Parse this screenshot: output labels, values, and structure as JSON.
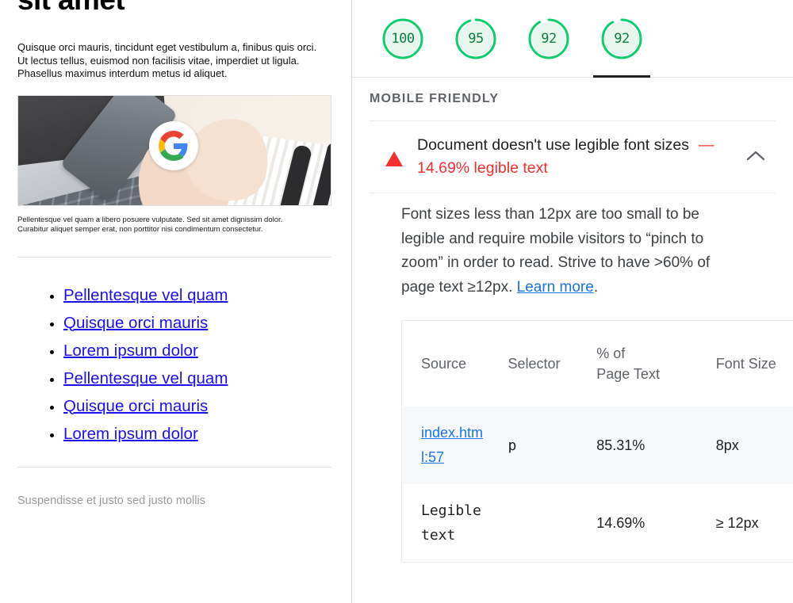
{
  "page_preview": {
    "heading": "sit amet",
    "paragraph": "Quisque orci mauris, tincidunt eget vestibulum a, finibus quis orci. Ut lectus tellus, euismod non facilisis vitae, imperdiet ut ligula. Phasellus maximus interdum metus id aliquet.",
    "image_alt": "hands-holding-phone-over-laptop-with-google-logo",
    "caption": "Pellentesque vel quam a libero posuere vulputate. Sed sit amet dignissim dolor. Curabitur aliquet semper erat, non porttitor nisi condimentum consectetur.",
    "links": [
      "Pellentesque vel quam",
      "Quisque orci mauris",
      "Lorem ipsum dolor",
      "Pellentesque vel quam",
      "Quisque orci mauris",
      "Lorem ipsum dolor"
    ],
    "footer": "Suspendisse et justo sed justo mollis",
    "link_color": "#1a12ee",
    "footer_color": "#9a9a9a"
  },
  "audit_pane": {
    "gauges": [
      {
        "score": "100",
        "percent": 100,
        "active": false,
        "color": "#0cce6b"
      },
      {
        "score": "95",
        "percent": 95,
        "active": false,
        "color": "#0cce6b"
      },
      {
        "score": "92",
        "percent": 92,
        "active": false,
        "color": "#0cce6b"
      },
      {
        "score": "92",
        "percent": 92,
        "active": true,
        "color": "#0cce6b"
      }
    ],
    "section_header": "MOBILE FRIENDLY",
    "audit": {
      "title": "Document doesn't use legible font sizes",
      "title_dash": "—",
      "subtitle": "14.69% legible text",
      "warning_color": "#f4302e",
      "collapse_icon": "chevron-up-icon",
      "description_before_link": "Font sizes less than 12px are too small to be legible and require mobile visitors to “pinch to zoom” in order to read. Strive to have >60% of page text ≥12px. ",
      "description_link": "Learn more",
      "description_after_link": "."
    },
    "table": {
      "headers": [
        "Source",
        "Selector",
        "% of Page Text",
        "Font Size"
      ],
      "header_pct_line1": "% of",
      "header_pct_line2": "Page Text",
      "rows": [
        {
          "source": "index.html:57",
          "selector": "p",
          "percent": "85.31%",
          "font_size": "8px",
          "source_is_link": true,
          "zebra": true
        },
        {
          "source": "Legible text",
          "selector": "",
          "percent": "14.69%",
          "font_size": "≥ 12px",
          "source_is_link": false,
          "zebra": false
        }
      ]
    }
  }
}
